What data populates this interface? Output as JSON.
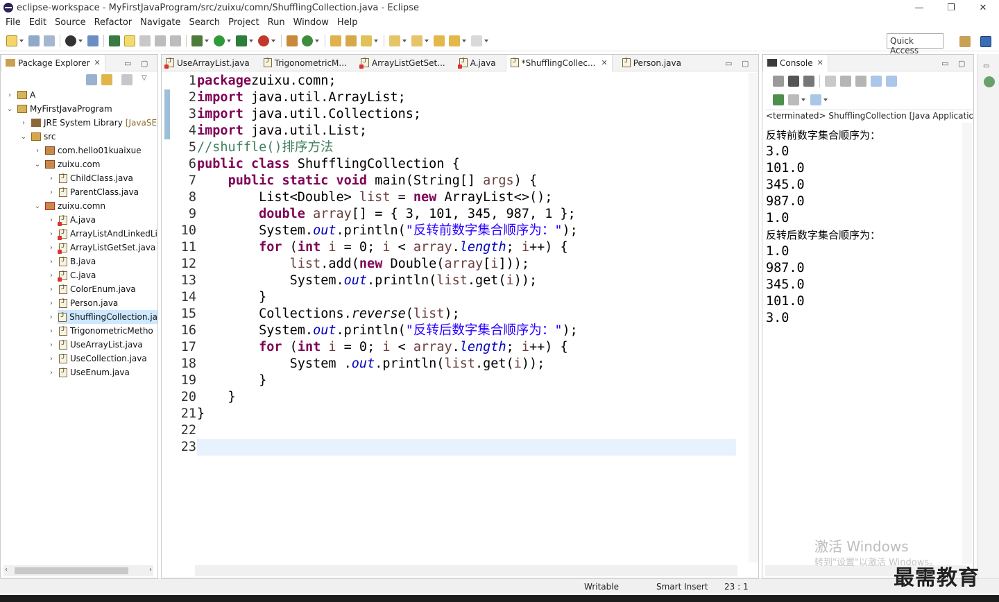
{
  "window": {
    "title": "eclipse-workspace - MyFirstJavaProgram/src/zuixu/comn/ShufflingCollection.java - Eclipse",
    "controls": {
      "minimize": "—",
      "restore": "❐",
      "close": "✕"
    }
  },
  "menu": [
    "File",
    "Edit",
    "Source",
    "Refactor",
    "Navigate",
    "Search",
    "Project",
    "Run",
    "Window",
    "Help"
  ],
  "toolbar": {
    "quick_access": "Quick Access"
  },
  "package_explorer": {
    "title": "Package Explorer",
    "items": [
      {
        "label": "A",
        "arrow": "›",
        "icon": "project"
      },
      {
        "label": "MyFirstJavaProgram",
        "arrow": "⌄",
        "icon": "project"
      },
      {
        "label": "JRE System Library",
        "suffix": "[JavaSE-",
        "arrow": "›",
        "icon": "library"
      },
      {
        "label": "src",
        "arrow": "⌄",
        "icon": "src"
      },
      {
        "label": "com.hello01kuaixue",
        "arrow": "›",
        "icon": "package"
      },
      {
        "label": "zuixu.com",
        "arrow": "⌄",
        "icon": "package"
      },
      {
        "label": "ChildClass.java",
        "arrow": "›",
        "icon": "java"
      },
      {
        "label": "ParentClass.java",
        "arrow": "›",
        "icon": "java"
      },
      {
        "label": "zuixu.comn",
        "arrow": "⌄",
        "icon": "package-err"
      },
      {
        "label": "A.java",
        "arrow": "›",
        "icon": "java-err"
      },
      {
        "label": "ArrayListAndLinkedLi",
        "arrow": "›",
        "icon": "java-err"
      },
      {
        "label": "ArrayListGetSet.java",
        "arrow": "›",
        "icon": "java-err"
      },
      {
        "label": "B.java",
        "arrow": "›",
        "icon": "java"
      },
      {
        "label": "C.java",
        "arrow": "›",
        "icon": "java-err"
      },
      {
        "label": "ColorEnum.java",
        "arrow": "›",
        "icon": "java"
      },
      {
        "label": "Person.java",
        "arrow": "›",
        "icon": "java"
      },
      {
        "label": "ShufflingCollection.ja",
        "arrow": "›",
        "icon": "java",
        "selected": true
      },
      {
        "label": "TrigonometricMetho",
        "arrow": "›",
        "icon": "java"
      },
      {
        "label": "UseArrayList.java",
        "arrow": "›",
        "icon": "java"
      },
      {
        "label": "UseCollection.java",
        "arrow": "›",
        "icon": "java"
      },
      {
        "label": "UseEnum.java",
        "arrow": "›",
        "icon": "java"
      }
    ]
  },
  "editor": {
    "tabs": [
      {
        "label": "UseArrayList.java",
        "err": true
      },
      {
        "label": "TrigonometricM...",
        "err": false
      },
      {
        "label": "ArrayListGetSet...",
        "err": true
      },
      {
        "label": "A.java",
        "err": true
      },
      {
        "label": "*ShufflingCollec...",
        "err": false,
        "active": true,
        "close": "✕"
      },
      {
        "label": "Person.java",
        "err": false
      }
    ],
    "line_numbers": [
      "1",
      "2",
      "3",
      "4",
      "5",
      "6",
      "7",
      "8",
      "9",
      "10",
      "11",
      "12",
      "13",
      "14",
      "15",
      "16",
      "17",
      "18",
      "19",
      "20",
      "21",
      "22",
      "23"
    ],
    "code_lines": [
      [
        [
          "kw",
          "package"
        ],
        [
          "",
          "zuixu.comn;"
        ]
      ],
      [
        [
          "kw",
          "import"
        ],
        [
          "",
          " java.util.ArrayList;"
        ]
      ],
      [
        [
          "kw",
          "import"
        ],
        [
          "",
          " java.util.Collections;"
        ]
      ],
      [
        [
          "kw",
          "import"
        ],
        [
          "",
          " java.util.List;"
        ]
      ],
      [
        [
          "cmt",
          "//shuffle()排序方法"
        ]
      ],
      [
        [
          "kw",
          "public"
        ],
        [
          "",
          " "
        ],
        [
          "kw",
          "class"
        ],
        [
          "",
          " ShufflingCollection {"
        ]
      ],
      [
        [
          "",
          "    "
        ],
        [
          "kw",
          "public"
        ],
        [
          "",
          " "
        ],
        [
          "kw",
          "static"
        ],
        [
          "",
          " "
        ],
        [
          "kw",
          "void"
        ],
        [
          "",
          " main(String[] "
        ],
        [
          "var",
          "args"
        ],
        [
          "",
          ") {"
        ]
      ],
      [
        [
          "",
          "        List<Double> "
        ],
        [
          "var",
          "list"
        ],
        [
          "",
          " = "
        ],
        [
          "kw",
          "new"
        ],
        [
          "",
          " ArrayList<>();"
        ]
      ],
      [
        [
          "",
          "        "
        ],
        [
          "kw",
          "double"
        ],
        [
          "",
          " "
        ],
        [
          "var",
          "array"
        ],
        [
          "",
          "[] = { 3, 101, 345, 987, 1 };"
        ]
      ],
      [
        [
          "",
          "        System."
        ],
        [
          "fld",
          "out"
        ],
        [
          "",
          ".println("
        ],
        [
          "str",
          "\"反转前数字集合顺序为：\""
        ],
        [
          "",
          ");"
        ]
      ],
      [
        [
          "",
          "        "
        ],
        [
          "kw",
          "for"
        ],
        [
          "",
          " ("
        ],
        [
          "kw",
          "int"
        ],
        [
          "",
          " "
        ],
        [
          "var",
          "i"
        ],
        [
          "",
          " = 0; "
        ],
        [
          "var",
          "i"
        ],
        [
          "",
          " < "
        ],
        [
          "var",
          "array"
        ],
        [
          "",
          "."
        ],
        [
          "fld",
          "length"
        ],
        [
          "",
          "; "
        ],
        [
          "var",
          "i"
        ],
        [
          "",
          "++) {"
        ]
      ],
      [
        [
          "",
          "            "
        ],
        [
          "var",
          "list"
        ],
        [
          "",
          ".add("
        ],
        [
          "kw",
          "new"
        ],
        [
          "",
          " Double("
        ],
        [
          "var",
          "array"
        ],
        [
          "",
          "["
        ],
        [
          "var",
          "i"
        ],
        [
          "",
          "]));"
        ]
      ],
      [
        [
          "",
          "            System."
        ],
        [
          "fld",
          "out"
        ],
        [
          "",
          ".println("
        ],
        [
          "var",
          "list"
        ],
        [
          "",
          ".get("
        ],
        [
          "var",
          "i"
        ],
        [
          "",
          "));"
        ]
      ],
      [
        [
          "",
          "        }"
        ]
      ],
      [
        [
          "",
          "        Collections."
        ],
        [
          "ital",
          "reverse"
        ],
        [
          "",
          "("
        ],
        [
          "var",
          "list"
        ],
        [
          "",
          ");"
        ]
      ],
      [
        [
          "",
          "        System."
        ],
        [
          "fld",
          "out"
        ],
        [
          "",
          ".println("
        ],
        [
          "str",
          "\"反转后数字集合顺序为：\""
        ],
        [
          "",
          ");"
        ]
      ],
      [
        [
          "",
          "        "
        ],
        [
          "kw",
          "for"
        ],
        [
          "",
          " ("
        ],
        [
          "kw",
          "int"
        ],
        [
          "",
          " "
        ],
        [
          "var",
          "i"
        ],
        [
          "",
          " = 0; "
        ],
        [
          "var",
          "i"
        ],
        [
          "",
          " < "
        ],
        [
          "var",
          "array"
        ],
        [
          "",
          "."
        ],
        [
          "fld",
          "length"
        ],
        [
          "",
          "; "
        ],
        [
          "var",
          "i"
        ],
        [
          "",
          "++) {"
        ]
      ],
      [
        [
          "",
          "            System ."
        ],
        [
          "fld",
          "out"
        ],
        [
          "",
          ".println("
        ],
        [
          "var",
          "list"
        ],
        [
          "",
          ".get("
        ],
        [
          "var",
          "i"
        ],
        [
          "",
          "));"
        ]
      ],
      [
        [
          "",
          "        }"
        ]
      ],
      [
        [
          "",
          "    }"
        ]
      ],
      [
        [
          "",
          "}"
        ]
      ],
      [
        [
          "",
          ""
        ]
      ],
      [
        [
          "",
          ""
        ]
      ]
    ]
  },
  "console": {
    "title": "Console",
    "status": "<terminated> ShufflingCollection [Java Application]",
    "output": [
      "反转前数字集合顺序为：",
      "3.0",
      "101.0",
      "345.0",
      "987.0",
      "1.0",
      "反转后数字集合顺序为：",
      "1.0",
      "987.0",
      "345.0",
      "101.0",
      "3.0"
    ]
  },
  "status_bar": {
    "mode": "Writable",
    "insert": "Smart Insert",
    "position": "23 : 1"
  },
  "watermark": {
    "line1": "激活 Windows",
    "line2": "转到\"设置\"以激活 Windows。",
    "brand": "最需教育"
  },
  "colors": {
    "keyword": "#7f0055",
    "string": "#2a00ff",
    "comment": "#3f7f5f",
    "field": "#0000c0",
    "variable": "#6a3e3e",
    "selection": "#cde8ff",
    "current_line": "#e8f2fe"
  }
}
